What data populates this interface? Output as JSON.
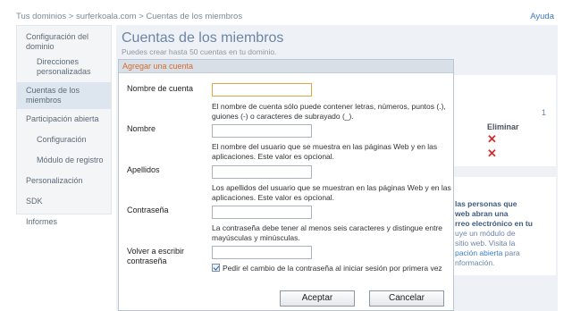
{
  "breadcrumb": "Tus dominios > surferkoala.com > Cuentas de los miembros",
  "help": "Ayuda",
  "sidebar": {
    "items": [
      {
        "label": "Configuración del dominio"
      },
      {
        "label": "Direcciones personalizadas"
      },
      {
        "label": "Cuentas de los miembros"
      },
      {
        "label": "Participación abierta"
      },
      {
        "label": "Configuración"
      },
      {
        "label": "Módulo de registro"
      },
      {
        "label": "Personalización"
      },
      {
        "label": "SDK"
      },
      {
        "label": "Informes"
      }
    ]
  },
  "main": {
    "title": "Cuentas de los miembros",
    "subtitle": "Puedes crear hasta 50 cuentas en tu dominio.",
    "count": "1",
    "eliminar": "Eliminar",
    "promo": {
      "line1": "las personas que",
      "line2": "web abran una",
      "line3": "rreo electrónico en tu",
      "line4": "uye un módulo de",
      "line5": "sitio web. Visita la",
      "line6_link": "pación abierta",
      "line6_rest": " para",
      "line7": "nformación."
    }
  },
  "dialog": {
    "title": "Agregar una cuenta",
    "fields": {
      "account_name": {
        "label": "Nombre de cuenta",
        "value": "",
        "help": "El nombre de cuenta sólo puede contener letras, números, puntos (.), guiones (-) o caracteres de subrayado (_)."
      },
      "first_name": {
        "label": "Nombre",
        "value": "",
        "help": "El nombre del usuario que se muestra en las páginas Web y en las aplicaciones. Este valor es opcional."
      },
      "last_name": {
        "label": "Apellidos",
        "value": "",
        "help": "Los apellidos del usuario que se muestran en las páginas Web y en las aplicaciones. Este valor es opcional."
      },
      "password": {
        "label": "Contraseña",
        "value": "",
        "help": "La contraseña debe tener al menos seis caracteres y distingue entre mayúsculas y minúsculas."
      },
      "confirm_password": {
        "label": "Volver a escribir contraseña",
        "value": ""
      }
    },
    "force_change_checkbox": {
      "checked": true,
      "label": "Pedir el cambio de la contraseña al iniciar sesión por primera vez"
    },
    "accept_label": "Aceptar",
    "cancel_label": "Cancelar"
  },
  "colors": {
    "accent": "#6b84a6",
    "dialog_title": "#d56a30",
    "delete": "#d23030",
    "link": "#3a7bc8"
  }
}
